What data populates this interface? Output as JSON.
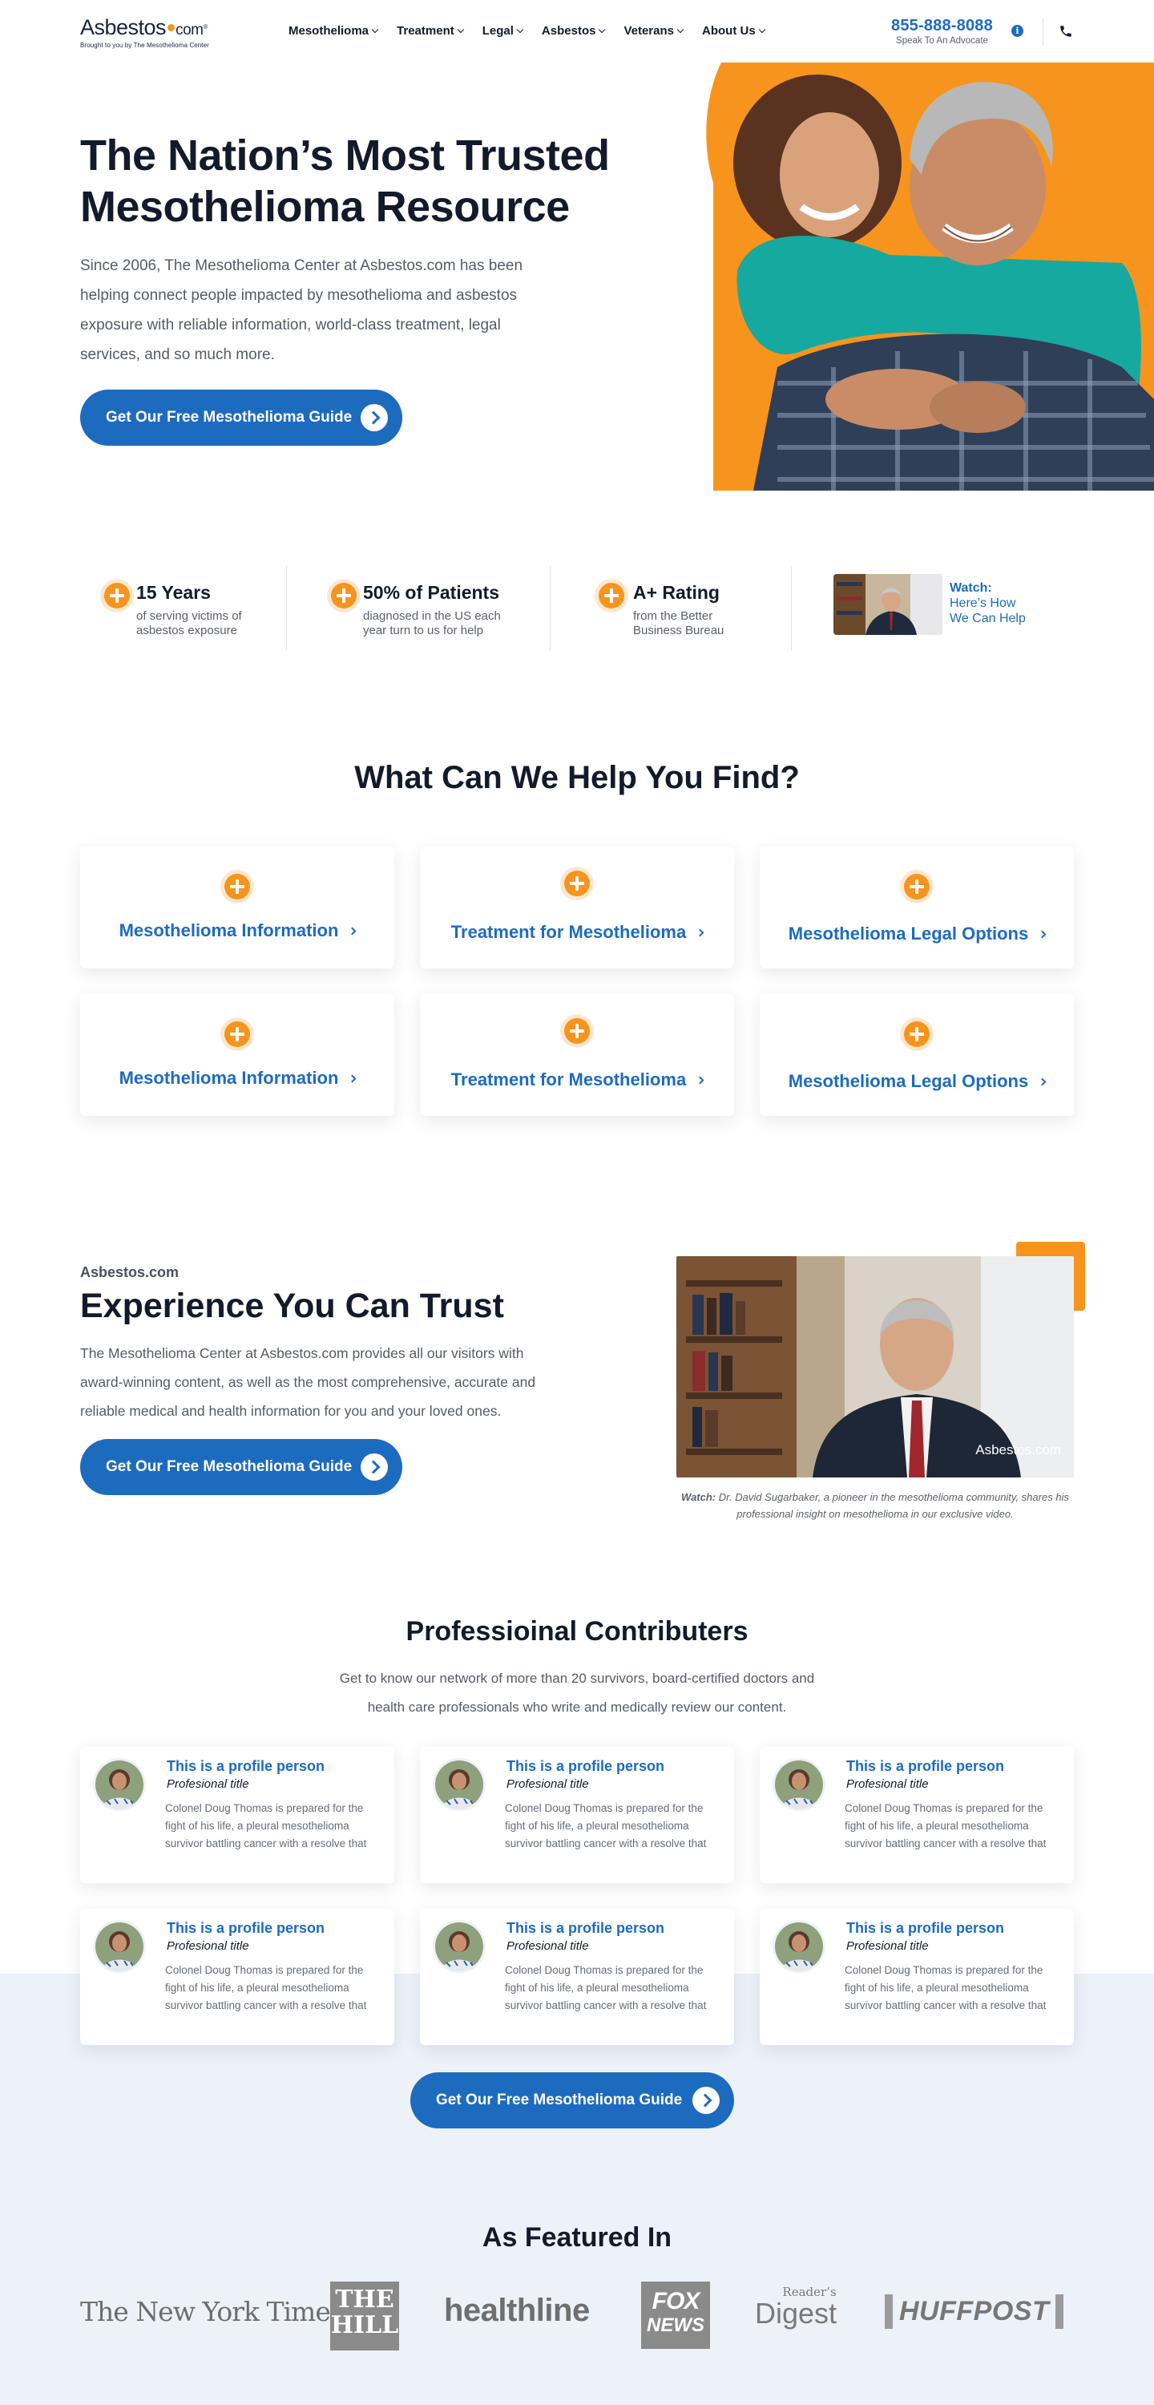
{
  "header": {
    "logo_main": "Asbestos",
    "logo_com": "com",
    "logo_reg": "®",
    "logo_tagline": "Brought to you by The Mesothelioma Center",
    "nav": [
      "Mesothelioma",
      "Treatment",
      "Legal",
      "Asbestos",
      "Veterans",
      "About Us"
    ],
    "phone": "855-888-8088",
    "phone_sub": "Speak To An Advocate",
    "info_glyph": "i",
    "icons": {
      "info": "info-icon",
      "phone": "phone-icon",
      "dropdown": "chevron-down-icon"
    }
  },
  "hero": {
    "title": "The Nation’s Most Trusted Mesothelioma Resource",
    "text": "Since 2006, The Mesothelioma Center at Asbestos.com has been helping connect people impacted by mesothelioma and asbestos exposure with reliable information, world-class treatment, legal services, and so much more.",
    "cta": "Get Our Free Mesothelioma Guide",
    "image": "smiling-couple-photo"
  },
  "stats": [
    {
      "title": "15 Years",
      "text": "of serving victims of asbestos exposure"
    },
    {
      "title": "50% of Patients",
      "text": "diagnosed in the US each year turn to us for help"
    },
    {
      "title": "A+ Rating",
      "text": "from the Better Business Bureau"
    }
  ],
  "watch": {
    "label": "Watch:",
    "text": "Here’s How We Can Help"
  },
  "help": {
    "title": "What Can We Help You Find?",
    "cards": [
      "Mesothelioma Information",
      "Treatment for Mesothelioma",
      "Mesothelioma Legal Options",
      "Mesothelioma Information",
      "Treatment for Mesothelioma",
      "Mesothelioma Legal Options"
    ]
  },
  "experience": {
    "eyebrow": "Asbestos.com",
    "title": "Experience You Can Trust",
    "text": "The Mesothelioma Center at Asbestos.com provides all our visitors with award-winning content, as well as the most comprehensive, accurate and reliable medical and health information for you and your loved ones.",
    "cta": "Get Our Free Mesothelioma Guide",
    "video_watermark": "Asbestos.com",
    "caption_label": "Watch:",
    "caption": "Dr. David Sugarbaker, a pioneer in the mesothelioma community, shares his professional insight on mesothelioma in our exclusive video."
  },
  "contributors": {
    "title": "Professioinal Contributers",
    "text": "Get to know our network of more than 20 survivors, board-certified doctors and health care professionals who write and medically review our content.",
    "profiles": [
      {
        "name": "This is a profile person",
        "role": "Profesional title",
        "bio": "Colonel Doug Thomas is prepared for the fight of his life, a pleural mesothelioma survivor battling cancer with a resolve that"
      },
      {
        "name": "This is a profile person",
        "role": "Profesional title",
        "bio": "Colonel Doug Thomas is prepared for the fight of his life, a pleural mesothelioma survivor battling cancer with a resolve that"
      },
      {
        "name": "This is a profile person",
        "role": "Profesional title",
        "bio": "Colonel Doug Thomas is prepared for the fight of his life, a pleural mesothelioma survivor battling cancer with a resolve that"
      },
      {
        "name": "This is a profile person",
        "role": "Profesional title",
        "bio": "Colonel Doug Thomas is prepared for the fight of his life, a pleural mesothelioma survivor battling cancer with a resolve that"
      },
      {
        "name": "This is a profile person",
        "role": "Profesional title",
        "bio": "Colonel Doug Thomas is prepared for the fight of his life, a pleural mesothelioma survivor battling cancer with a resolve that"
      },
      {
        "name": "This is a profile person",
        "role": "Profesional title",
        "bio": "Colonel Doug Thomas is prepared for the fight of his life, a pleural mesothelioma survivor battling cancer with a resolve that"
      }
    ],
    "cta": "Get Our Free Mesothelioma Guide"
  },
  "featured": {
    "title": "As Featured In",
    "logos": {
      "nyt": "The New York Times",
      "hill_1": "THE",
      "hill_2": "HILL",
      "healthline": "healthline",
      "fox_1": "FOX",
      "fox_2": "NEWS",
      "rd_1": "Reader’s",
      "rd_2": "Digest",
      "huffpost": "HUFFPOST"
    }
  },
  "colors": {
    "primary": "#1d6bbf",
    "accent": "#f7941d",
    "heading": "#131a2b",
    "band": "#edf2f9"
  }
}
